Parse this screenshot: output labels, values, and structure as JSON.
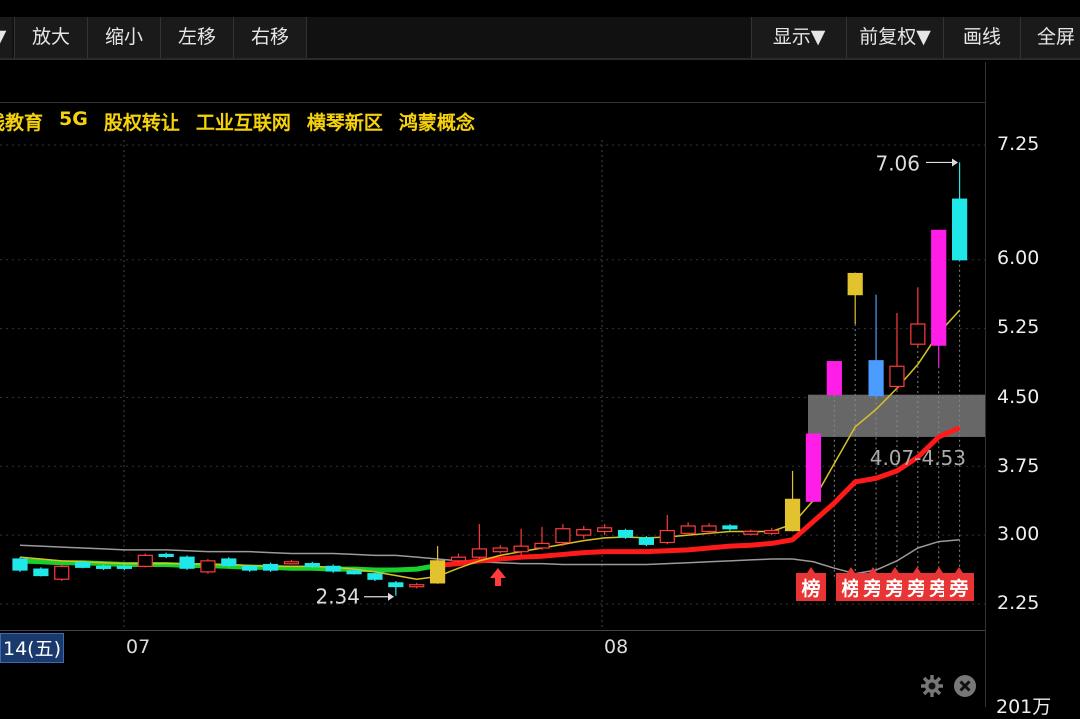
{
  "toolbar": {
    "left_arrow": "▼",
    "buttons": [
      "放大",
      "缩小",
      "左移",
      "右移"
    ],
    "right_buttons": [
      "显示▼",
      "前复权▼",
      "画线",
      "全屏"
    ]
  },
  "concepts": [
    "线教育",
    "5G",
    "股权转让",
    "工业互联网",
    "横琴新区",
    "鸿蒙概念"
  ],
  "chart_data": {
    "type": "candlestick",
    "y_ticks": [
      "7.25",
      "6.00",
      "5.25",
      "4.50",
      "3.75",
      "3.00",
      "2.25"
    ],
    "ylim": [
      2.0,
      7.5
    ],
    "x_labels": {
      "date_cursor": "14(五)",
      "month_07": "07",
      "month_08": "08"
    },
    "annotations": {
      "high": "7.06",
      "low": "2.34",
      "zone": "4.07-4.53",
      "bottom_value": "201万"
    },
    "badges": [
      "榜",
      "榜",
      "旁",
      "旁",
      "旁",
      "旁",
      "旁"
    ],
    "candles": [
      {
        "o": 2.74,
        "c": 2.62,
        "h": 2.76,
        "l": 2.6,
        "color": "cyan"
      },
      {
        "o": 2.63,
        "c": 2.56,
        "h": 2.65,
        "l": 2.55,
        "color": "cyan"
      },
      {
        "o": 2.52,
        "c": 2.66,
        "h": 2.68,
        "l": 2.5,
        "color": "red"
      },
      {
        "o": 2.7,
        "c": 2.65,
        "h": 2.72,
        "l": 2.64,
        "color": "cyan"
      },
      {
        "o": 2.66,
        "c": 2.65,
        "h": 2.68,
        "l": 2.62,
        "color": "cyan"
      },
      {
        "o": 2.66,
        "c": 2.64,
        "h": 2.68,
        "l": 2.62,
        "color": "cyan"
      },
      {
        "o": 2.66,
        "c": 2.78,
        "h": 2.8,
        "l": 2.65,
        "color": "red"
      },
      {
        "o": 2.79,
        "c": 2.77,
        "h": 2.81,
        "l": 2.75,
        "color": "cyan"
      },
      {
        "o": 2.76,
        "c": 2.64,
        "h": 2.78,
        "l": 2.62,
        "color": "cyan"
      },
      {
        "o": 2.6,
        "c": 2.72,
        "h": 2.74,
        "l": 2.58,
        "color": "red"
      },
      {
        "o": 2.74,
        "c": 2.67,
        "h": 2.76,
        "l": 2.65,
        "color": "cyan"
      },
      {
        "o": 2.66,
        "c": 2.62,
        "h": 2.68,
        "l": 2.6,
        "color": "cyan"
      },
      {
        "o": 2.68,
        "c": 2.62,
        "h": 2.7,
        "l": 2.6,
        "color": "cyan"
      },
      {
        "o": 2.7,
        "c": 2.71,
        "h": 2.73,
        "l": 2.68,
        "color": "red"
      },
      {
        "o": 2.69,
        "c": 2.66,
        "h": 2.71,
        "l": 2.64,
        "color": "cyan"
      },
      {
        "o": 2.66,
        "c": 2.61,
        "h": 2.68,
        "l": 2.59,
        "color": "cyan"
      },
      {
        "o": 2.61,
        "c": 2.58,
        "h": 2.63,
        "l": 2.57,
        "color": "cyan"
      },
      {
        "o": 2.58,
        "c": 2.52,
        "h": 2.59,
        "l": 2.5,
        "color": "cyan"
      },
      {
        "o": 2.48,
        "c": 2.44,
        "h": 2.5,
        "l": 2.34,
        "color": "cyan"
      },
      {
        "o": 2.45,
        "c": 2.46,
        "h": 2.48,
        "l": 2.42,
        "color": "red"
      },
      {
        "o": 2.48,
        "c": 2.72,
        "h": 2.88,
        "l": 2.47,
        "color": "yellow"
      },
      {
        "o": 2.72,
        "c": 2.76,
        "h": 2.8,
        "l": 2.7,
        "color": "red"
      },
      {
        "o": 2.76,
        "c": 2.85,
        "h": 3.12,
        "l": 2.74,
        "color": "red"
      },
      {
        "o": 2.82,
        "c": 2.86,
        "h": 2.89,
        "l": 2.8,
        "color": "red"
      },
      {
        "o": 2.82,
        "c": 2.88,
        "h": 3.07,
        "l": 2.78,
        "color": "red"
      },
      {
        "o": 2.86,
        "c": 2.91,
        "h": 3.09,
        "l": 2.84,
        "color": "red"
      },
      {
        "o": 2.92,
        "c": 3.07,
        "h": 3.12,
        "l": 2.88,
        "color": "red"
      },
      {
        "o": 3.0,
        "c": 3.06,
        "h": 3.1,
        "l": 2.96,
        "color": "red"
      },
      {
        "o": 3.04,
        "c": 3.08,
        "h": 3.12,
        "l": 3.0,
        "color": "red"
      },
      {
        "o": 3.05,
        "c": 2.98,
        "h": 3.07,
        "l": 2.96,
        "color": "cyan"
      },
      {
        "o": 2.97,
        "c": 2.9,
        "h": 2.99,
        "l": 2.88,
        "color": "cyan"
      },
      {
        "o": 2.92,
        "c": 3.05,
        "h": 3.22,
        "l": 2.9,
        "color": "red"
      },
      {
        "o": 3.02,
        "c": 3.1,
        "h": 3.14,
        "l": 3.0,
        "color": "red"
      },
      {
        "o": 3.04,
        "c": 3.1,
        "h": 3.13,
        "l": 3.01,
        "color": "red"
      },
      {
        "o": 3.1,
        "c": 3.07,
        "h": 3.12,
        "l": 3.05,
        "color": "cyan"
      },
      {
        "o": 3.01,
        "c": 3.04,
        "h": 3.06,
        "l": 3.0,
        "color": "red"
      },
      {
        "o": 3.02,
        "c": 3.05,
        "h": 3.08,
        "l": 3.0,
        "color": "red"
      },
      {
        "o": 3.05,
        "c": 3.39,
        "h": 3.7,
        "l": 3.04,
        "color": "yellow"
      },
      {
        "o": 3.37,
        "c": 4.1,
        "h": 4.1,
        "l": 3.36,
        "color": "magenta"
      },
      {
        "o": 4.53,
        "c": 4.89,
        "h": 4.89,
        "l": 4.53,
        "color": "magenta"
      },
      {
        "o": 5.62,
        "c": 5.85,
        "h": 5.86,
        "l": 5.3,
        "color": "yellow"
      },
      {
        "o": 4.9,
        "c": 4.52,
        "h": 5.62,
        "l": 4.5,
        "color": "blue"
      },
      {
        "o": 4.62,
        "c": 4.84,
        "h": 5.42,
        "l": 4.58,
        "color": "red"
      },
      {
        "o": 5.08,
        "c": 5.3,
        "h": 5.7,
        "l": 5.06,
        "color": "red"
      },
      {
        "o": 5.07,
        "c": 6.32,
        "h": 6.32,
        "l": 4.84,
        "color": "magenta"
      },
      {
        "o": 6.0,
        "c": 6.66,
        "h": 7.06,
        "l": 6.0,
        "color": "cyan"
      }
    ],
    "ma_red": [
      2.72,
      2.71,
      2.7,
      2.7,
      2.69,
      2.68,
      2.68,
      2.68,
      2.67,
      2.67,
      2.66,
      2.65,
      2.65,
      2.64,
      2.64,
      2.63,
      2.63,
      2.62,
      2.62,
      2.63,
      2.67,
      2.69,
      2.72,
      2.74,
      2.76,
      2.77,
      2.79,
      2.81,
      2.82,
      2.82,
      2.82,
      2.83,
      2.84,
      2.86,
      2.88,
      2.89,
      2.91,
      2.95,
      3.15,
      3.35,
      3.58,
      3.62,
      3.7,
      3.85,
      4.07,
      4.17
    ],
    "ma_green_until": 20,
    "ma_yellow": [
      2.76,
      2.74,
      2.72,
      2.71,
      2.7,
      2.69,
      2.69,
      2.69,
      2.69,
      2.68,
      2.68,
      2.67,
      2.66,
      2.66,
      2.66,
      2.65,
      2.63,
      2.6,
      2.56,
      2.52,
      2.55,
      2.64,
      2.72,
      2.78,
      2.82,
      2.86,
      2.9,
      2.94,
      2.97,
      2.98,
      2.97,
      2.98,
      3.0,
      3.02,
      3.04,
      3.04,
      3.04,
      3.12,
      3.38,
      3.78,
      4.18,
      4.37,
      4.6,
      4.86,
      5.2,
      5.45
    ],
    "ma_gray": [
      2.89,
      2.88,
      2.87,
      2.86,
      2.85,
      2.84,
      2.84,
      2.84,
      2.83,
      2.82,
      2.82,
      2.82,
      2.81,
      2.8,
      2.8,
      2.8,
      2.79,
      2.78,
      2.78,
      2.76,
      2.74,
      2.72,
      2.71,
      2.7,
      2.69,
      2.69,
      2.68,
      2.68,
      2.68,
      2.68,
      2.68,
      2.69,
      2.7,
      2.71,
      2.72,
      2.73,
      2.74,
      2.74,
      2.71,
      2.64,
      2.58,
      2.62,
      2.72,
      2.86,
      2.93,
      2.95
    ]
  }
}
